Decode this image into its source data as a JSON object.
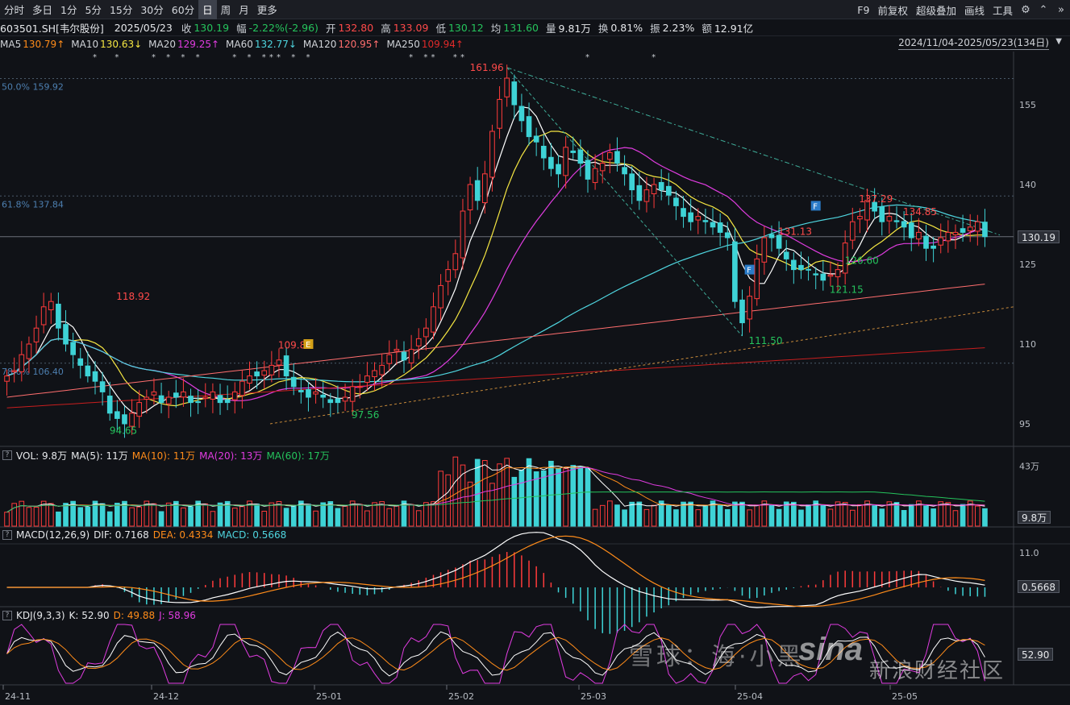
{
  "toolbar": {
    "periods": [
      "分时",
      "多日",
      "1分",
      "5分",
      "15分",
      "30分",
      "60分",
      "日",
      "周",
      "月",
      "更多"
    ],
    "active_period": "日",
    "right_buttons": [
      "F9",
      "前复权",
      "超级叠加",
      "画线",
      "工具"
    ],
    "icons": [
      "gear-icon",
      "collapse-up-icon",
      "expand-double-icon"
    ]
  },
  "info": {
    "symbol": "603501.SH[韦尔股份]",
    "date": "2025/05/23",
    "close_label": "收",
    "close": "130.19",
    "change_label": "幅",
    "change": "-2.22%(-2.96)",
    "open_label": "开",
    "open": "132.80",
    "high_label": "高",
    "high": "133.09",
    "low_label": "低",
    "low": "130.12",
    "avg_label": "均",
    "avg": "131.60",
    "vol_label": "量",
    "vol": "9.81万",
    "turnover_label": "换",
    "turnover": "0.81%",
    "amplitude_label": "振",
    "amplitude": "2.23%",
    "amount_label": "额",
    "amount": "12.91亿"
  },
  "ma_row": [
    {
      "label": "MA5",
      "value": "130.79↑",
      "color": "#ff8c1a"
    },
    {
      "label": "MA10",
      "value": "130.63↓",
      "color": "#f5e642"
    },
    {
      "label": "MA20",
      "value": "129.25↑",
      "color": "#e03ce0"
    },
    {
      "label": "MA60",
      "value": "132.77↓",
      "color": "#4fd6e0"
    },
    {
      "label": "MA120",
      "value": "120.95↑",
      "color": "#ff6e6e"
    },
    {
      "label": "MA250",
      "value": "109.94↑",
      "color": "#e02a2a"
    }
  ],
  "date_range": "2024/11/04-2025/05/23(134日)",
  "main_price_tag": "130.19",
  "fib": [
    {
      "label": "50.0%  159.92",
      "price": 159.92
    },
    {
      "label": "61.8%  137.84",
      "price": 137.84
    },
    {
      "label": "78.6%  106.40",
      "price": 106.4
    }
  ],
  "annotations": [
    {
      "text": "161.96",
      "kind": "high"
    },
    {
      "text": "118.92",
      "kind": "high"
    },
    {
      "text": "109.80",
      "kind": "high"
    },
    {
      "text": "137.29",
      "kind": "high"
    },
    {
      "text": "134.85",
      "kind": "high"
    },
    {
      "text": "131.13",
      "kind": "high"
    },
    {
      "text": "94.65",
      "kind": "low"
    },
    {
      "text": "97.56",
      "kind": "low"
    },
    {
      "text": "111.50",
      "kind": "low"
    },
    {
      "text": "121.15",
      "kind": "low"
    },
    {
      "text": "126.60",
      "kind": "low"
    }
  ],
  "markers": [
    "E",
    "F",
    "F"
  ],
  "vol_panel": {
    "title": "VOL: 9.8万",
    "ma5": "MA(5): 11万",
    "ma10": "MA(10): 11万",
    "ma20": "MA(20): 13万",
    "ma60": "MA(60): 17万",
    "axis_top": "43万",
    "tag": "9.8万"
  },
  "macd_panel": {
    "title": "MACD(12,26,9)",
    "dif": "DIF: 0.7168",
    "dea": "DEA: 0.4334",
    "macd": "MACD: 0.5668",
    "axis_top": "11.0",
    "tag": "0.5668"
  },
  "kdj_panel": {
    "title": "KDJ(9,3,3)",
    "k": "K: 52.90",
    "d": "D: 49.88",
    "j": "J: 58.96",
    "tag": "52.90"
  },
  "x_labels": [
    "24-11",
    "24-12",
    "25-01",
    "25-02",
    "25-03",
    "25-04",
    "25-05"
  ],
  "watermark": {
    "xueqiu": "雪球：海·小黑",
    "sina": "sina",
    "sina_cn": "新浪财经社区"
  },
  "chart_data": {
    "type": "candlestick",
    "symbol": "603501.SH",
    "y_ticks": [
      95,
      110,
      125,
      140,
      155
    ],
    "x_labels": [
      "24-11",
      "24-12",
      "25-01",
      "25-02",
      "25-03",
      "25-04",
      "25-05"
    ],
    "key_points": [
      {
        "x": "24-11",
        "label": "118.92",
        "type": "high"
      },
      {
        "x": "24-11",
        "label": "94.65",
        "type": "low"
      },
      {
        "x": "24-12",
        "label": "109.80",
        "type": "high"
      },
      {
        "x": "25-01",
        "label": "97.56",
        "type": "low"
      },
      {
        "x": "25-02",
        "label": "161.96",
        "type": "high"
      },
      {
        "x": "25-04",
        "label": "111.50",
        "type": "low"
      },
      {
        "x": "25-04",
        "label": "131.13",
        "type": "high"
      },
      {
        "x": "25-04",
        "label": "121.15",
        "type": "low"
      },
      {
        "x": "25-05",
        "label": "137.29",
        "type": "high"
      },
      {
        "x": "25-05",
        "label": "134.85",
        "type": "high"
      },
      {
        "x": "25-05",
        "label": "126.60",
        "type": "low"
      }
    ],
    "last_close": 130.19,
    "closes": [
      104,
      105,
      108,
      110,
      113,
      117,
      118,
      113,
      110,
      108,
      106,
      104,
      103,
      101,
      97,
      96,
      95,
      97,
      99,
      100,
      101,
      99,
      100,
      100,
      101,
      99,
      99,
      100,
      101,
      99,
      99,
      101,
      103,
      104,
      104,
      105,
      106,
      107,
      104,
      102,
      101,
      100,
      101,
      100,
      99,
      99,
      100,
      102,
      102,
      104,
      105,
      106,
      108,
      109,
      107,
      109,
      111,
      113,
      117,
      121,
      124,
      127,
      135,
      140,
      137,
      142,
      150,
      156,
      160,
      155,
      152,
      149,
      148,
      145,
      143,
      142,
      147,
      146,
      144,
      141,
      143,
      144,
      146,
      144,
      142,
      139,
      137,
      139,
      140,
      139,
      138,
      136,
      134,
      133,
      134,
      133,
      132,
      131,
      130,
      118,
      114,
      119,
      126,
      130,
      130,
      128,
      126,
      124,
      124,
      124,
      123,
      122,
      123,
      124,
      129,
      133,
      134,
      137,
      135,
      133,
      134,
      133,
      132,
      130,
      131,
      128,
      128,
      130,
      131,
      131,
      131,
      132,
      133,
      130.19
    ],
    "ma_series_present": [
      "MA5",
      "MA10",
      "MA20",
      "MA60",
      "MA120",
      "MA250"
    ]
  }
}
